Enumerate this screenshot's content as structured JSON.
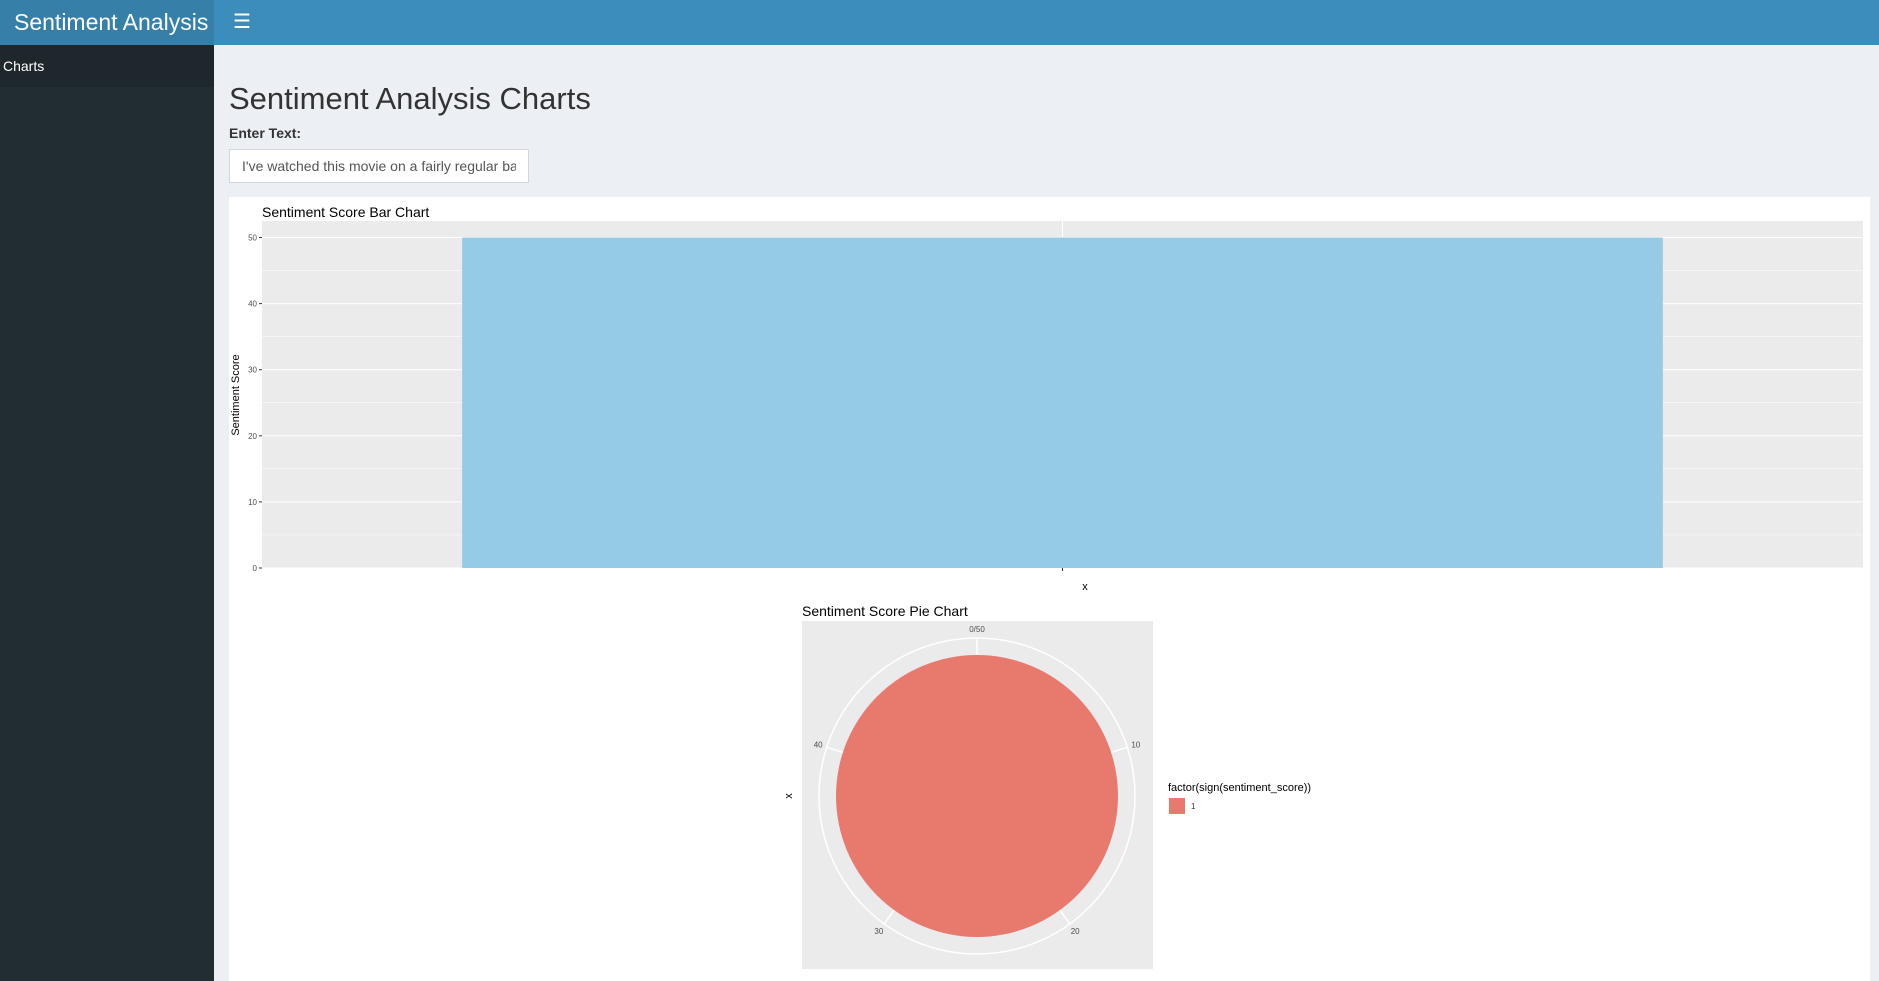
{
  "app": {
    "title": "Sentiment Analysis"
  },
  "sidebar": {
    "items": [
      {
        "label": "Charts"
      }
    ]
  },
  "header": {
    "menu_icon": "hamburger-icon"
  },
  "main": {
    "title": "Sentiment Analysis Charts",
    "input": {
      "label": "Enter Text:",
      "value": "I've watched this movie on a fairly regular basis"
    }
  },
  "chart_data": [
    {
      "type": "bar",
      "title": "Sentiment Score Bar Chart",
      "xlabel": "x",
      "ylabel": "Sentiment Score",
      "categories": [
        ""
      ],
      "values": [
        50
      ],
      "ylim": [
        0,
        52.5
      ],
      "yticks": [
        0,
        10,
        20,
        30,
        40,
        50
      ],
      "grid": true,
      "colors": {
        "bar": "#96cbe6",
        "panel": "#ebebeb",
        "grid": "#ffffff"
      }
    },
    {
      "type": "pie",
      "title": "Sentiment Score Pie Chart",
      "xlabel": "x",
      "ylabel": "",
      "slices": [
        {
          "label": "1",
          "value": 50
        }
      ],
      "angle_ticks": [
        "0/50",
        "10",
        "20",
        "30",
        "40"
      ],
      "legend": {
        "title": "factor(sign(sentiment_score))",
        "entries": [
          "1"
        ],
        "position": "right"
      },
      "colors": {
        "slice": "#e8796d",
        "panel": "#ebebeb"
      }
    }
  ]
}
